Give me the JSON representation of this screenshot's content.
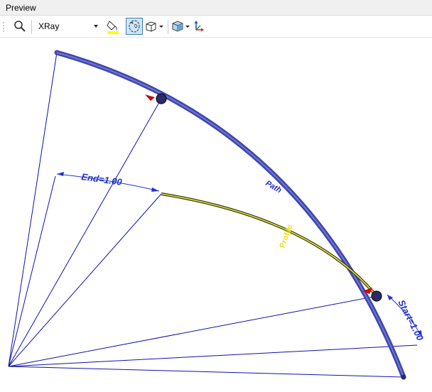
{
  "panel": {
    "title": "Preview"
  },
  "toolbar": {
    "display_mode": {
      "value": "XRay",
      "options": [
        "XRay"
      ]
    },
    "buttons": [
      {
        "name": "zoom-icon"
      },
      {
        "name": "paint-bucket-icon",
        "accent": "#ffff00"
      },
      {
        "name": "rotate-view-icon",
        "active": true
      },
      {
        "name": "box-view-icon"
      },
      {
        "name": "cube-view-icon"
      },
      {
        "name": "axis-triad-icon"
      }
    ]
  },
  "viewport": {
    "labels": {
      "end": "End=1.00",
      "start": "Start=1.00",
      "path": "Path",
      "profile": "Profile"
    },
    "colors": {
      "path_curve": "#4048b0",
      "construction_lines": "#1010b0",
      "profile_curve": "#e0e040",
      "dimension": "#2233cc",
      "marker": "#e00000"
    }
  }
}
